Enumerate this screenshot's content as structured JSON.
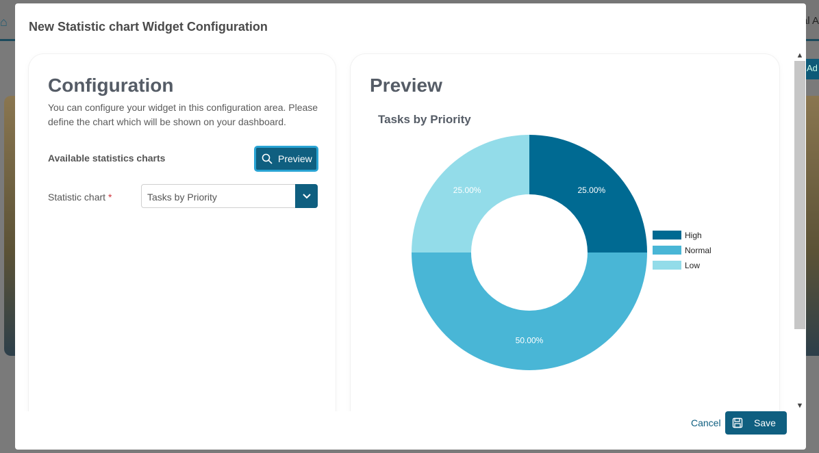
{
  "background": {
    "right_text": "al A",
    "add_text": "Ad"
  },
  "modal": {
    "title": "New Statistic chart Widget Configuration"
  },
  "config": {
    "heading": "Configuration",
    "description": "You can configure your widget in this configuration area. Please define the chart which will be shown on your dashboard.",
    "available_label": "Available statistics charts",
    "preview_button": "Preview",
    "field_label": "Statistic chart",
    "required_mark": "*",
    "selected_chart": "Tasks by Priority"
  },
  "preview": {
    "heading": "Preview"
  },
  "chart_data": {
    "type": "pie",
    "variant": "donut",
    "title": "Tasks by Priority",
    "categories": [
      "High",
      "Normal",
      "Low"
    ],
    "values": [
      25,
      50,
      25
    ],
    "labels": [
      "25.00%",
      "50.00%",
      "25.00%"
    ],
    "colors": [
      "#006a92",
      "#49b6d6",
      "#93dce9"
    ],
    "legend_placement": "right"
  },
  "footer": {
    "cancel": "Cancel",
    "save": "Save"
  },
  "colors": {
    "primary": "#0f5f80",
    "focus_ring": "#2aa4d4",
    "required": "#d0323a"
  }
}
